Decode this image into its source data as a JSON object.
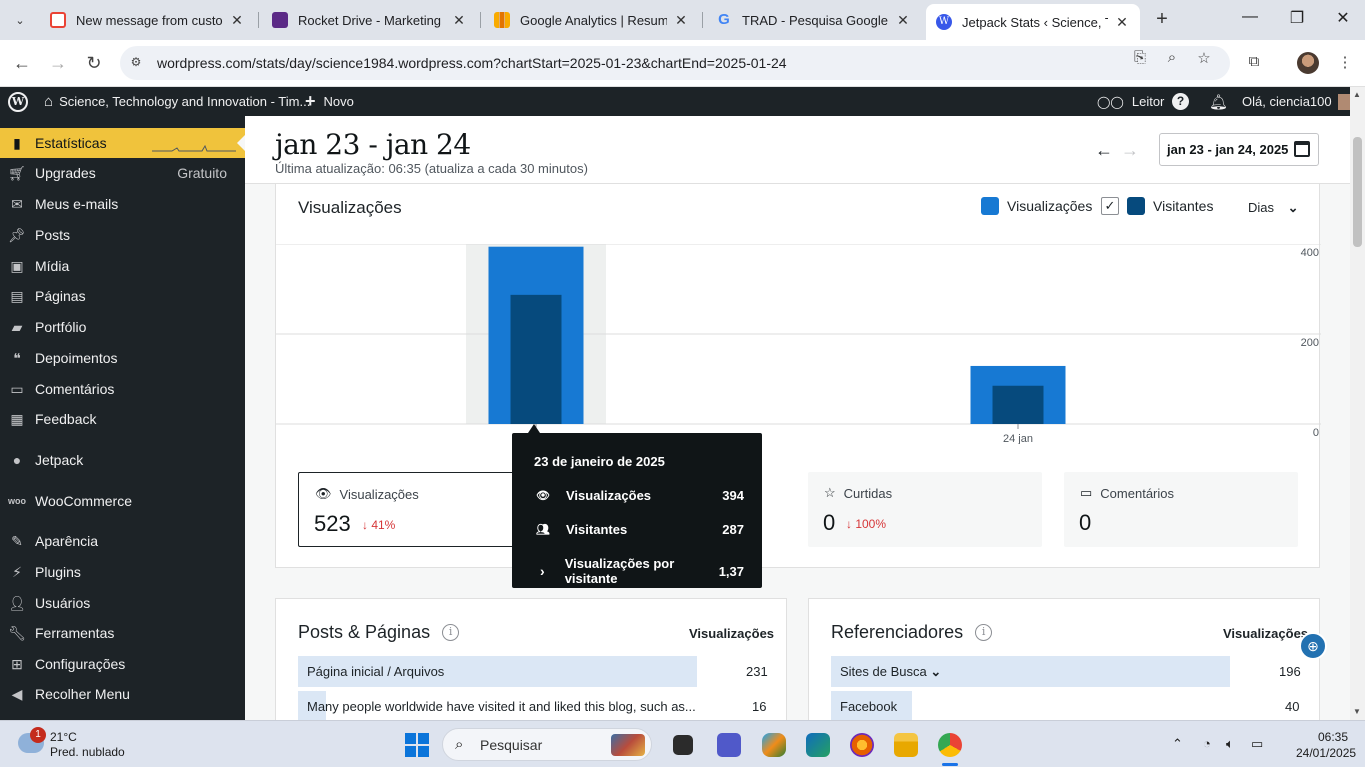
{
  "browser": {
    "tabs": [
      {
        "title": "New message from custome",
        "favicon": "gmail-icon",
        "color": "#ea4335"
      },
      {
        "title": "Rocket Drive - Marketing So",
        "favicon": "rocket-drive-icon",
        "color": "#5b2a86"
      },
      {
        "title": "Google Analytics | Resumo d",
        "favicon": "analytics-icon",
        "color": "#f9ab00"
      },
      {
        "title": "TRAD - Pesquisa Google",
        "favicon": "google-icon",
        "color": "#4285f4"
      },
      {
        "title": "Jetpack Stats ‹ Science, Tech",
        "favicon": "wordpress-icon",
        "color": "#3858e9",
        "active": true
      }
    ],
    "url": "wordpress.com/stats/day/science1984.wordpress.com?chartStart=2025-01-23&chartEnd=2025-01-24"
  },
  "adminbar": {
    "site": "Science, Technology and Innovation - Tim...",
    "new": "Novo",
    "reader": "Leitor",
    "greeting": "Olá, ciencia100"
  },
  "sidebar": {
    "items": [
      {
        "label": "Estatísticas",
        "icon": "chart-icon",
        "active": true
      },
      {
        "label": "Upgrades",
        "icon": "cart-icon",
        "extra": "Gratuito"
      },
      {
        "label": "Meus e-mails",
        "icon": "mail-icon"
      },
      {
        "label": "Posts",
        "icon": "pin-icon"
      },
      {
        "label": "Mídia",
        "icon": "media-icon"
      },
      {
        "label": "Páginas",
        "icon": "pages-icon"
      },
      {
        "label": "Portfólio",
        "icon": "folder-icon"
      },
      {
        "label": "Depoimentos",
        "icon": "testimonial-icon"
      },
      {
        "label": "Comentários",
        "icon": "comment-icon"
      },
      {
        "label": "Feedback",
        "icon": "feedback-icon"
      },
      {
        "label": "Jetpack",
        "icon": "jetpack-icon"
      },
      {
        "label": "WooCommerce",
        "icon": "woo-icon"
      },
      {
        "label": "Aparência",
        "icon": "brush-icon"
      },
      {
        "label": "Plugins",
        "icon": "plugin-icon"
      },
      {
        "label": "Usuários",
        "icon": "user-icon"
      },
      {
        "label": "Ferramentas",
        "icon": "wrench-icon"
      },
      {
        "label": "Configurações",
        "icon": "settings-icon"
      },
      {
        "label": "Recolher Menu",
        "icon": "collapse-icon"
      }
    ]
  },
  "header": {
    "title": "jan 23 - jan 24",
    "subtitle": "Última atualização: 06:35 (atualiza a cada 30 minutos)",
    "date_range": "jan 23 - jan 24, 2025"
  },
  "chart_card": {
    "title": "Visualizações",
    "legend_views": "Visualizações",
    "legend_visitors": "Visitantes",
    "period": "Dias",
    "color_views": "#1779d3",
    "color_visitors": "#064a7d"
  },
  "chart_data": {
    "type": "bar",
    "categories": [
      "23 jan",
      "24 jan"
    ],
    "x_tick_labels": [
      "",
      "24 jan"
    ],
    "series": [
      {
        "name": "Visualizações",
        "values": [
          394,
          129
        ]
      },
      {
        "name": "Visitantes",
        "values": [
          287,
          85
        ]
      }
    ],
    "y_ticks": [
      0,
      200,
      400
    ],
    "ylim": [
      0,
      400
    ],
    "grid": true,
    "highlighted": "23 jan"
  },
  "stats": [
    {
      "label": "Visualizações",
      "icon": "eye-icon",
      "value": "523",
      "change": "↓ 41%"
    },
    {
      "label": "Curtidas",
      "icon": "star-icon",
      "value": "0",
      "change": "↓ 100%"
    },
    {
      "label": "Comentários",
      "icon": "comment-icon",
      "value": "0",
      "change": ""
    }
  ],
  "tooltip": {
    "date": "23 de janeiro de 2025",
    "rows": [
      {
        "label": "Visualizações",
        "value": "394",
        "icon": "eye-icon"
      },
      {
        "label": "Visitantes",
        "value": "287",
        "icon": "people-icon"
      },
      {
        "label": "Visualizações por visitante",
        "value": "1,37",
        "icon": "chevron-right-icon"
      }
    ]
  },
  "posts_panel": {
    "title": "Posts & Páginas",
    "col": "Visualizações",
    "rows": [
      {
        "label": "Página inicial / Arquivos",
        "value": "231",
        "fill": 1.0
      },
      {
        "label": "Many people worldwide have visited it and liked this blog, such as...",
        "value": "16",
        "fill": 0.07
      }
    ]
  },
  "referrers_panel": {
    "title": "Referenciadores",
    "col": "Visualizações",
    "rows": [
      {
        "label": "Sites de Busca",
        "value": "196",
        "fill": 1.0,
        "expand": "⌄"
      },
      {
        "label": "Facebook",
        "value": "40",
        "fill": 0.2
      }
    ]
  },
  "taskbar": {
    "weather_temp": "21°C",
    "weather_desc": "Pred. nublado",
    "weather_badge": "1",
    "search": "Pesquisar",
    "time": "06:35",
    "date": "24/01/2025"
  }
}
